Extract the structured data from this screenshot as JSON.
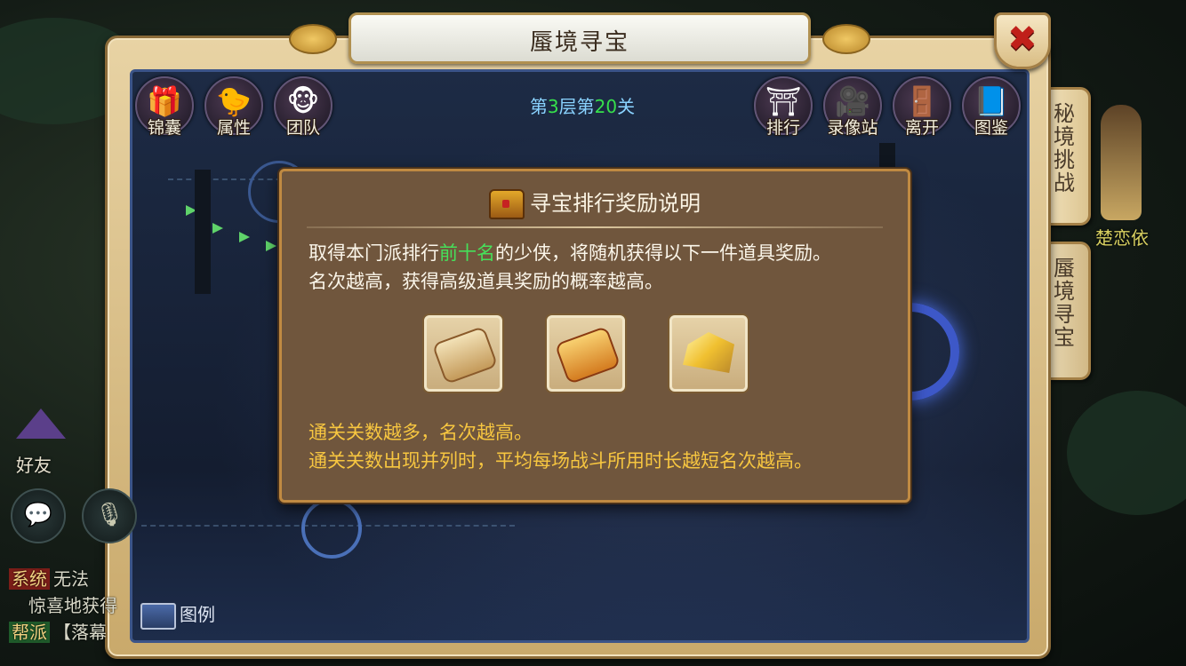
{
  "window": {
    "title": "蜃境寻宝",
    "close_icon": "close-icon"
  },
  "level": {
    "prefix": "第",
    "floor": "3",
    "mid": "层第",
    "stage": "20",
    "suffix": "关"
  },
  "top_left_buttons": [
    {
      "label": "锦囊",
      "icon": "pouch-icon"
    },
    {
      "label": "属性",
      "icon": "chick-icon"
    },
    {
      "label": "团队",
      "icon": "monkey-icon"
    }
  ],
  "top_right_buttons": [
    {
      "label": "排行",
      "icon": "gate-icon"
    },
    {
      "label": "录像站",
      "icon": "video-camera-icon"
    },
    {
      "label": "离开",
      "icon": "exit-door-icon"
    },
    {
      "label": "图鉴",
      "icon": "book-icon"
    }
  ],
  "side_tabs": [
    {
      "label": "秘境挑战"
    },
    {
      "label": "蜃境寻宝"
    }
  ],
  "character": {
    "name": "楚恋依"
  },
  "hud": {
    "friend_label": "好友",
    "chat_lines": [
      {
        "tag": "系统",
        "text": "无法"
      },
      {
        "tag": "",
        "text": "惊喜地获得"
      },
      {
        "tag": "帮派",
        "text": "【落幕"
      }
    ]
  },
  "legend": {
    "label": "图例"
  },
  "dialog": {
    "title": "寻宝排行奖励说明",
    "desc_1a": "取得本门派排行",
    "desc_1b": "前十名",
    "desc_1c": "的少侠，将随机获得以下一件道具奖励。",
    "desc_2": "名次越高，获得高级道具奖励的概率越高。",
    "reward_items": [
      {
        "icon": "scroll-icon"
      },
      {
        "icon": "golden-scroll-icon"
      },
      {
        "icon": "gold-ingot-icon"
      }
    ],
    "rule_1": "通关关数越多，名次越高。",
    "rule_2": "通关关数出现并列时，平均每场战斗所用时长越短名次越高。"
  },
  "colors": {
    "highlight_green": "#46e05a",
    "rules_yellow": "#f7c640",
    "close_red": "#c0201a"
  }
}
